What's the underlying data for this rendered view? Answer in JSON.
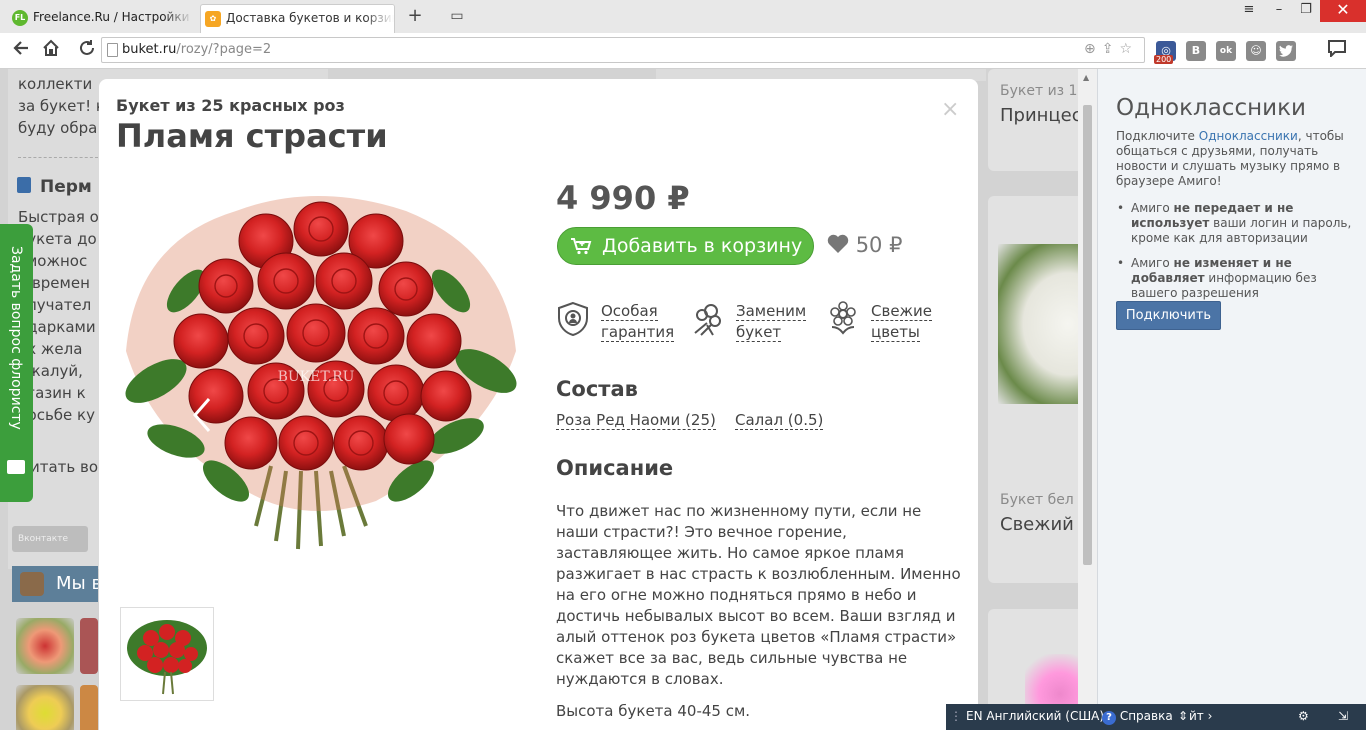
{
  "browser": {
    "tabs": [
      {
        "title": "Freelance.Ru / Настройки - М",
        "favicon": "fl"
      },
      {
        "title": "Доставка букетов и корзин с",
        "favicon": "buket"
      }
    ],
    "favicon_fl_text": "FL",
    "new_tab_label": "+",
    "window_controls": {
      "menu": "≡",
      "minimize": "–",
      "restore": "❐",
      "close": "✕"
    },
    "url_domain": "buket.ru",
    "url_path": "/rozy/?page=2",
    "extensions": [
      "B",
      "ok",
      "☺"
    ],
    "ext_badge": "200",
    "icons": {
      "back": "arrow-left",
      "home": "home",
      "reload": "reload",
      "bookmark": "star",
      "share": "share",
      "chat": "chat"
    }
  },
  "background_page": {
    "text_lines": [
      "коллекти",
      "за букет! к",
      "буду обра"
    ],
    "heading": "Перм",
    "body_lines": [
      "Быстрая о",
      "букета до",
      "зможнос",
      "о времен",
      "олучател",
      "одарками",
      "ех жела",
      "ожалуй,",
      "агазин к",
      "росьбе ку"
    ],
    "read_more": "итать во",
    "vk_label": "Вконтакте",
    "insta_label": "Мы в",
    "card1_category": "Букет из 1",
    "card1_name": "Принцес",
    "card2_category": "Букет бел",
    "card2_name": "Свежий"
  },
  "floating_tab": {
    "label": "Задать вопрос флористу"
  },
  "modal": {
    "subtitle": "Букет из 25 красных роз",
    "title": "Пламя страсти",
    "close": "×",
    "price": "4 990 ₽",
    "add_to_cart": "Добавить в корзину",
    "bonus": "50 ₽",
    "watermark": "BUKET.RU",
    "features": [
      {
        "line1": "Особая",
        "line2": "гарантия",
        "icon": "shield-icon"
      },
      {
        "line1": "Заменим",
        "line2": "букет",
        "icon": "bouquet-icon"
      },
      {
        "line1": "Свежие",
        "line2": "цветы",
        "icon": "flower-icon"
      }
    ],
    "composition_title": "Состав",
    "composition": [
      "Роза Ред Наоми (25)",
      "Салал (0.5)"
    ],
    "description_title": "Описание",
    "description": "Что движет нас по жизненному пути, если не наши страсти?! Это вечное горение, заставляющее жить. Но самое яркое пламя разжигает в нас страсть к возлюбленным. Именно на его огне можно подняться прямо в небо и достичь небывалых высот во всем. Ваши взгляд и алый оттенок роз букета цветов «Пламя страсти» скажет все за вас, ведь сильные чувства не нуждаются в словах.",
    "height_note": "Высота букета 40-45 см."
  },
  "side_panel": {
    "title": "Одноклассники",
    "intro_prefix": "Подключите ",
    "intro_link": "Одноклассники",
    "intro_suffix": ", чтобы общаться с друзьями, получать новости и слушать музыку прямо в браузере Амиго!",
    "bullets": [
      {
        "prefix": "Амиго ",
        "bold": "не передает и не использует",
        "suffix": " ваши логин и пароль, кроме как для авторизации"
      },
      {
        "prefix": "Амиго ",
        "bold": "не изменяет и не добавляет",
        "suffix": " информацию без вашего разрешения"
      }
    ],
    "connect_button": "Подключить"
  },
  "taskbar": {
    "language": "EN Английский (США)",
    "help": "Справка",
    "help_icon": "?",
    "partial": "йт ›"
  },
  "colors": {
    "accent_green": "#5dbb43",
    "amigo_blue": "#4b74a6",
    "rose_red": "#d42a2a"
  }
}
